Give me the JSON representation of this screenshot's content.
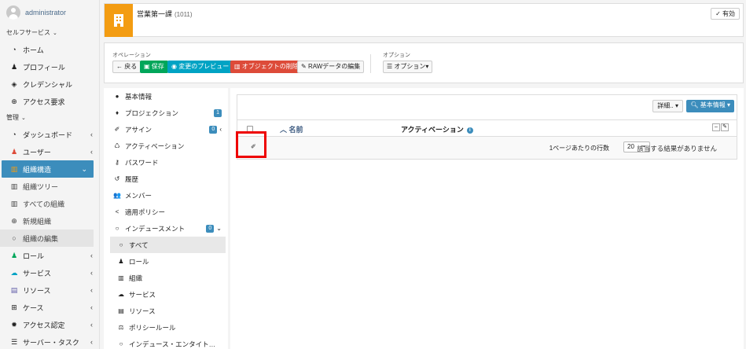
{
  "user": {
    "name": "administrator"
  },
  "sidebar": {
    "section_self": "セルフサービス",
    "self_items": [
      {
        "label": "ホーム",
        "icon": "dashboard-icon"
      },
      {
        "label": "プロフィール",
        "icon": "user-icon"
      },
      {
        "label": "クレデンシャル",
        "icon": "shield-icon"
      },
      {
        "label": "アクセス要求",
        "icon": "plus-circle-icon"
      }
    ],
    "section_admin": "管理",
    "admin_items": [
      {
        "label": "ダッシュボード",
        "icon": "dashboard-icon"
      },
      {
        "label": "ユーザー",
        "icon": "user-icon"
      },
      {
        "label": "組織構造",
        "icon": "building-icon"
      },
      {
        "label": "組織ツリー",
        "icon": "building-icon"
      },
      {
        "label": "すべての組織",
        "icon": "building-icon"
      },
      {
        "label": "新規組織",
        "icon": "plus-circle-icon"
      },
      {
        "label": "組織の編集",
        "icon": "circle-icon"
      },
      {
        "label": "ロール",
        "icon": "role-icon"
      },
      {
        "label": "サービス",
        "icon": "cloud-icon"
      },
      {
        "label": "リソース",
        "icon": "database-icon"
      },
      {
        "label": "ケース",
        "icon": "map-icon"
      },
      {
        "label": "アクセス認定",
        "icon": "certificate-icon"
      },
      {
        "label": "サーバー・タスク",
        "icon": "tasks-icon"
      }
    ]
  },
  "object": {
    "title": "営業第一課",
    "code": "(1011)",
    "status_label": "有効"
  },
  "operations": {
    "label": "オペレーション",
    "back": "戻る",
    "save": "保存",
    "preview": "変更のプレビュー",
    "delete": "オブジェクトの削除",
    "raw_edit": "RAWデータの編集",
    "options_label": "オプション",
    "options_button": "オプション"
  },
  "left_menu": {
    "items": [
      {
        "label": "基本情報",
        "icon": "●"
      },
      {
        "label": "プロジェクション",
        "icon": "♦",
        "badge": "1"
      },
      {
        "label": "アサイン",
        "icon": "✐",
        "badge": "0"
      },
      {
        "label": "アクティベーション",
        "icon": "♺"
      },
      {
        "label": "パスワード",
        "icon": "⚷"
      },
      {
        "label": "履歴",
        "icon": "↺"
      },
      {
        "label": "メンバー",
        "icon": "👥"
      },
      {
        "label": "適用ポリシー",
        "icon": "<"
      },
      {
        "label": "インデュースメント",
        "icon": "○",
        "badge": "0"
      }
    ],
    "sub_items": [
      {
        "label": "すべて",
        "icon": "○"
      },
      {
        "label": "ロール",
        "icon": "♟"
      },
      {
        "label": "組織",
        "icon": "▥"
      },
      {
        "label": "サービス",
        "icon": "☁"
      },
      {
        "label": "リソース",
        "icon": "▤"
      },
      {
        "label": "ポリシールール",
        "icon": "⚖"
      },
      {
        "label": "インデュース・エンタイト…",
        "icon": "○"
      }
    ]
  },
  "table": {
    "detail_button": "詳細..",
    "basic_button": "基本情報",
    "col_name": "名前",
    "col_activation": "アクティベーション",
    "rows_per_page_label": "1ページあたりの行数",
    "rows_per_page_value": "20",
    "empty_message": "該当する結果がありません"
  }
}
